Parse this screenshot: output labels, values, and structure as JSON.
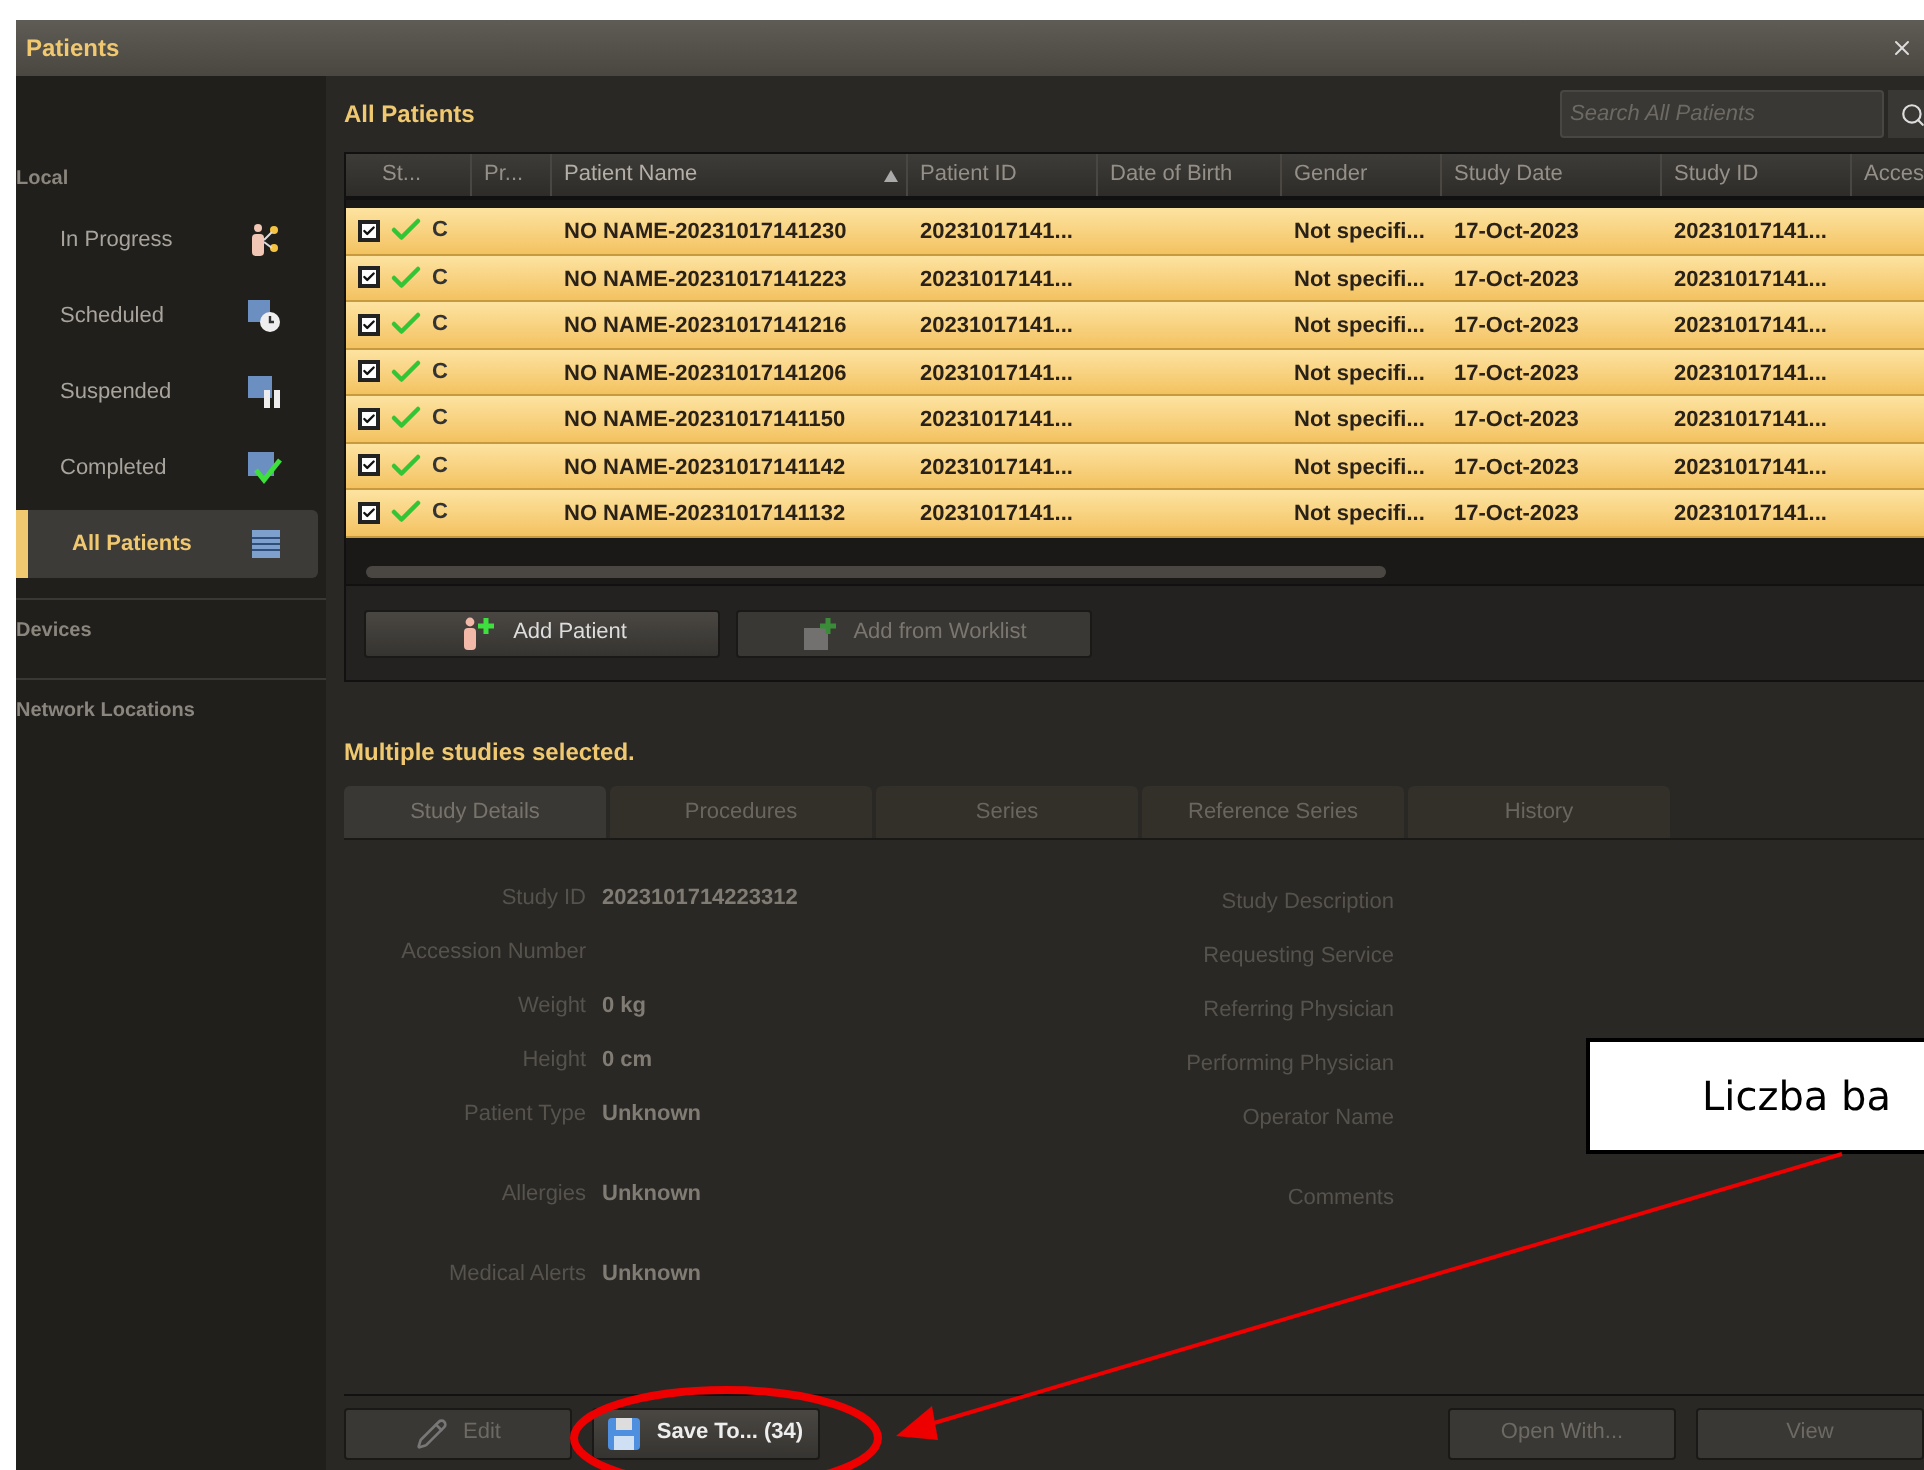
{
  "window": {
    "title": "Patients"
  },
  "sidebar": {
    "sections": [
      {
        "label": "Local",
        "items": [
          {
            "label": "In Progress",
            "kind": "progress",
            "selected": false
          },
          {
            "label": "Scheduled",
            "kind": "scheduled",
            "selected": false
          },
          {
            "label": "Suspended",
            "kind": "suspended",
            "selected": false
          },
          {
            "label": "Completed",
            "kind": "completed",
            "selected": false
          },
          {
            "label": "All Patients",
            "kind": "list",
            "selected": true
          }
        ]
      },
      {
        "label": "Devices"
      },
      {
        "label": "Network Locations"
      }
    ]
  },
  "patients": {
    "title": "All Patients",
    "search": {
      "placeholder": "Search All Patients"
    },
    "columns": [
      {
        "label": "St...",
        "sorted": false
      },
      {
        "label": "Pr...",
        "sorted": false
      },
      {
        "label": "Patient Name",
        "sorted": true
      },
      {
        "label": "Patient ID",
        "sorted": false
      },
      {
        "label": "Date of Birth",
        "sorted": false
      },
      {
        "label": "Gender",
        "sorted": false
      },
      {
        "label": "Study Date",
        "sorted": false
      },
      {
        "label": "Study ID",
        "sorted": false
      },
      {
        "label": "Acces",
        "sorted": false
      }
    ],
    "rows": [
      {
        "checked": true,
        "selected": true,
        "done": true,
        "status": "C",
        "name": "NO NAME-20231017141230",
        "patient_id": "20231017141...",
        "gender": "Not specifi...",
        "study_date": "17-Oct-2023",
        "study_id": "20231017141..."
      },
      {
        "checked": true,
        "selected": true,
        "done": true,
        "status": "C",
        "name": "NO NAME-20231017141223",
        "patient_id": "20231017141...",
        "gender": "Not specifi...",
        "study_date": "17-Oct-2023",
        "study_id": "20231017141..."
      },
      {
        "checked": true,
        "selected": true,
        "done": true,
        "status": "C",
        "name": "NO NAME-20231017141216",
        "patient_id": "20231017141...",
        "gender": "Not specifi...",
        "study_date": "17-Oct-2023",
        "study_id": "20231017141..."
      },
      {
        "checked": true,
        "selected": true,
        "done": true,
        "status": "C",
        "name": "NO NAME-20231017141206",
        "patient_id": "20231017141...",
        "gender": "Not specifi...",
        "study_date": "17-Oct-2023",
        "study_id": "20231017141..."
      },
      {
        "checked": true,
        "selected": true,
        "done": true,
        "status": "C",
        "name": "NO NAME-20231017141150",
        "patient_id": "20231017141...",
        "gender": "Not specifi...",
        "study_date": "17-Oct-2023",
        "study_id": "20231017141..."
      },
      {
        "checked": true,
        "selected": true,
        "done": true,
        "status": "C",
        "name": "NO NAME-20231017141142",
        "patient_id": "20231017141...",
        "gender": "Not specifi...",
        "study_date": "17-Oct-2023",
        "study_id": "20231017141..."
      },
      {
        "checked": true,
        "selected": true,
        "done": true,
        "status": "C",
        "name": "NO NAME-20231017141132",
        "patient_id": "20231017141...",
        "gender": "Not specifi...",
        "study_date": "17-Oct-2023",
        "study_id": "20231017141..."
      }
    ],
    "buttons": [
      {
        "label": "Add Patient",
        "kind": "add-person",
        "disabled": false
      },
      {
        "label": "Add from Worklist",
        "kind": "add-list",
        "disabled": true
      }
    ]
  },
  "details": {
    "message": "Multiple studies selected.",
    "tabs": [
      {
        "label": "Study Details",
        "selected": true
      },
      {
        "label": "Procedures",
        "selected": false
      },
      {
        "label": "Series",
        "selected": false
      },
      {
        "label": "Reference Series",
        "selected": false
      },
      {
        "label": "History",
        "selected": false
      }
    ],
    "left_groups": [
      [
        {
          "label": "Study ID",
          "value": "2023101714223312"
        },
        {
          "label": "Accession Number"
        },
        {
          "label": "Weight",
          "value": "0 kg"
        },
        {
          "label": "Height",
          "value": "0 cm"
        },
        {
          "label": "Patient Type",
          "value": "Unknown"
        }
      ],
      [
        {
          "label": "Allergies",
          "value": "Unknown"
        }
      ],
      [
        {
          "label": "Medical Alerts",
          "value": "Unknown"
        }
      ]
    ],
    "right_groups": [
      [
        {
          "label": "Study Description"
        },
        {
          "label": "Requesting Service"
        },
        {
          "label": "Referring Physician"
        },
        {
          "label": "Performing Physician"
        },
        {
          "label": "Operator Name"
        }
      ],
      [
        {
          "label": "Comments"
        }
      ]
    ]
  },
  "footer_left_buttons": [
    {
      "label": "Edit",
      "kind": "pencil",
      "disabled": true
    },
    {
      "label": "Save To... (34)",
      "kind": "disk",
      "disabled": false
    }
  ],
  "footer_right_buttons": [
    {
      "label": "Open With...",
      "disabled": true
    },
    {
      "label": "View",
      "disabled": true
    }
  ],
  "annotation": {
    "callout": "Liczba ba"
  }
}
